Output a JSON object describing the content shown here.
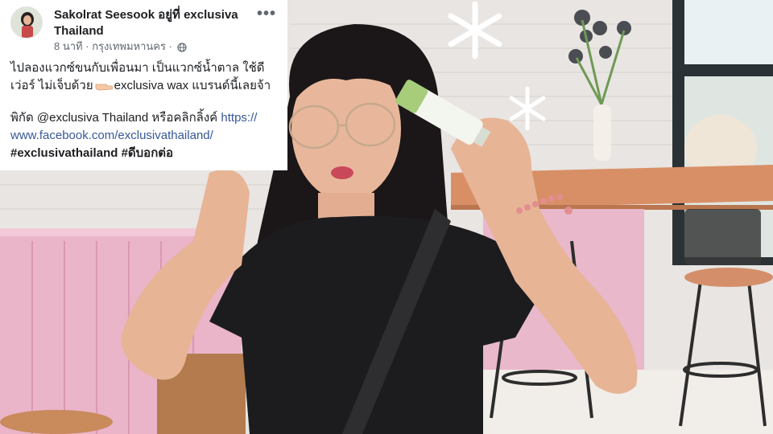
{
  "post": {
    "author": "Sakolrat Seesook",
    "location_prefix": "อยู่ที่",
    "location": "exclusiva Thailand",
    "time": "8 นาที",
    "place": "กรุงเทพมหานคร",
    "separator": "·",
    "more_icon": "more-options-icon",
    "privacy_icon": "globe-icon",
    "line1": "ไปลองแวกซ์ขนกับเพื่อนมา เป็นแวกซ์น้ำตาล ใช้ดี",
    "line2_a": "เว่อร์ ไม่เจ็บด้วย",
    "line2_b": "exclusiva wax แบรนด์นี้เลยจ้า",
    "emoji_icon": "pointing-hand-emoji",
    "line3_a": "พิกัด @exclusiva Thailand หรือคลิกลิ้งค์",
    "link_a": "https://",
    "link_b": "www.facebook.com/exclusivathailand/",
    "hashtag1": "#exclusivathailand",
    "hashtag2": "#ดีบอกต่อ"
  },
  "colors": {
    "link": "#385898",
    "text": "#1c1e21",
    "meta": "#606770"
  }
}
